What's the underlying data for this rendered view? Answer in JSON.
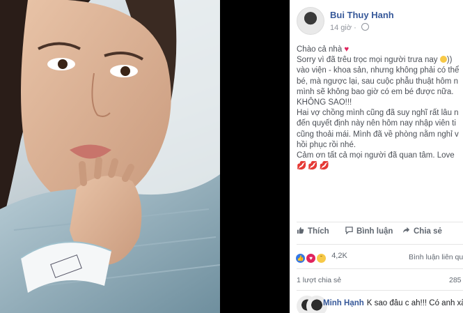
{
  "post": {
    "author": "Bui Thuy Hanh",
    "time": "14 giờ",
    "lines": [
      "Chào cả nhà",
      "Sorry vì đã trêu trọc mọi người trưa nay",
      "vào viện - khoa sản, nhưng không phải có thể",
      "bé, mà ngược lại, sau cuộc phẫu thuật hôm n",
      "mình sẽ không bao giờ có em bé được nữa.",
      "KHÔNG SAO!!!",
      "Hai vợ chồng mình cũng đã suy nghĩ rất lâu n",
      "đến quyết định này nên hôm nay nhập viên ti",
      "cũng thoải mái. Mình đã về phòng nằm nghỉ v",
      "hồi phục rồi nhé.",
      "Cảm ơn tất cả mọi người đã quan tâm. Love"
    ],
    "line2_suffix": "))"
  },
  "actions": {
    "like": "Thích",
    "comment": "Bình luận",
    "share": "Chia sẻ"
  },
  "stats": {
    "reactions_count": "4,2K",
    "comments_link": "Bình luận liên quan",
    "shares_label": "1 lượt chia sẻ",
    "shares_number": "285"
  },
  "comment": {
    "author": "Minh Hạnh",
    "text": "K sao đâu c ah!!! Có anh xã"
  },
  "colors": {
    "link_blue": "#365899",
    "heart_red": "#e0245e",
    "like_blue": "#3578e5"
  }
}
